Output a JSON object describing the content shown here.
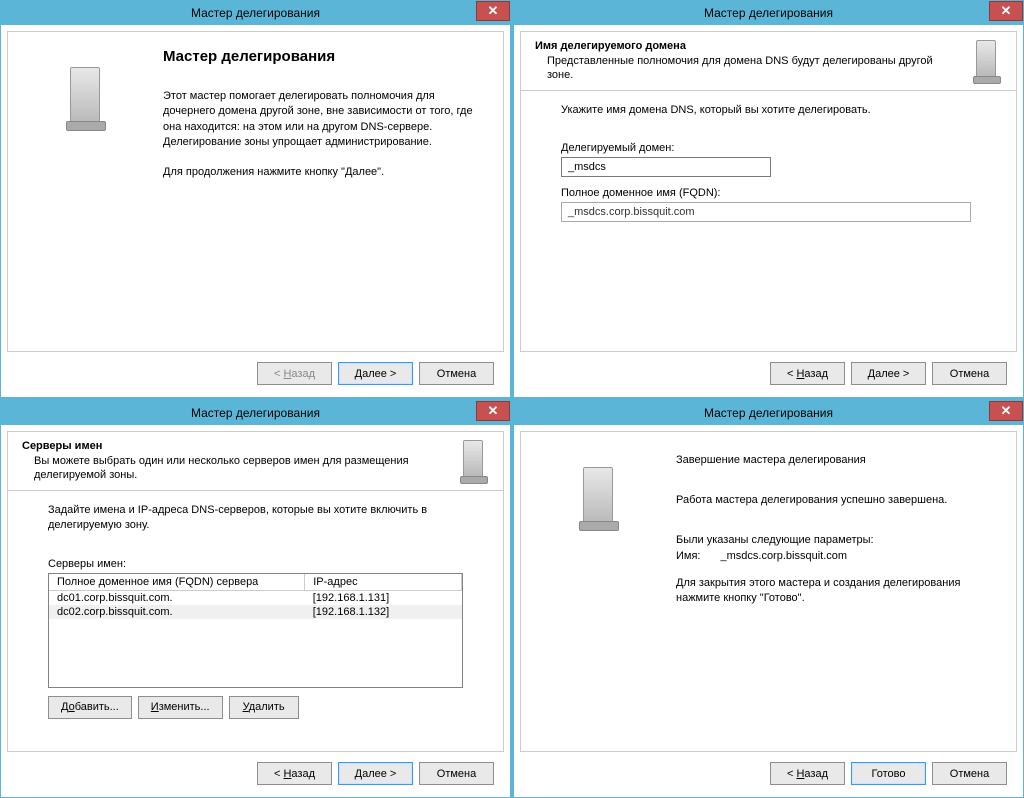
{
  "window_title": "Мастер делегирования",
  "close_glyph": "✕",
  "buttons": {
    "back": "< Назад",
    "next": "Далее >",
    "cancel": "Отмена",
    "finish": "Готово",
    "add": "Добавить...",
    "edit": "Изменить...",
    "delete": "Удалить"
  },
  "step1": {
    "title": "Мастер делегирования",
    "desc": "Этот мастер помогает делегировать полномочия для дочернего домена другой зоне, вне зависимости от того, где она находится: на этом или на другом DNS-сервере. Делегирование зоны упрощает администрирование.",
    "continue": "Для продолжения нажмите кнопку \"Далее\"."
  },
  "step2": {
    "header_title": "Имя делегируемого домена",
    "header_sub": "Представленные полномочия для домена DNS будут делегированы другой зоне.",
    "instruction": "Укажите имя домена DNS, который вы хотите делегировать.",
    "field1_label": "Делегируемый домен:",
    "field1_value": "_msdcs",
    "field2_label": "Полное доменное имя (FQDN):",
    "field2_value": "_msdcs.corp.bissquit.com"
  },
  "step3": {
    "header_title": "Серверы имен",
    "header_sub": "Вы можете выбрать один или несколько серверов имен для размещения делегируемой зоны.",
    "instruction": "Задайте имена и IP-адреса DNS-серверов, которые вы хотите включить в делегируемую зону.",
    "table_label": "Серверы имен:",
    "col1": "Полное доменное имя (FQDN) сервера",
    "col2": "IP-адрес",
    "rows": [
      {
        "fqdn": "dc01.corp.bissquit.com.",
        "ip": "[192.168.1.131]"
      },
      {
        "fqdn": "dc02.corp.bissquit.com.",
        "ip": "[192.168.1.132]"
      }
    ]
  },
  "step4": {
    "title": "Завершение мастера делегирования",
    "line1": "Работа мастера делегирования успешно завершена.",
    "line2": "Были указаны следующие параметры:",
    "kv_key": "Имя:",
    "kv_val": "_msdcs.corp.bissquit.com",
    "line3": "Для закрытия этого мастера и создания делегирования нажмите кнопку \"Готово\"."
  }
}
